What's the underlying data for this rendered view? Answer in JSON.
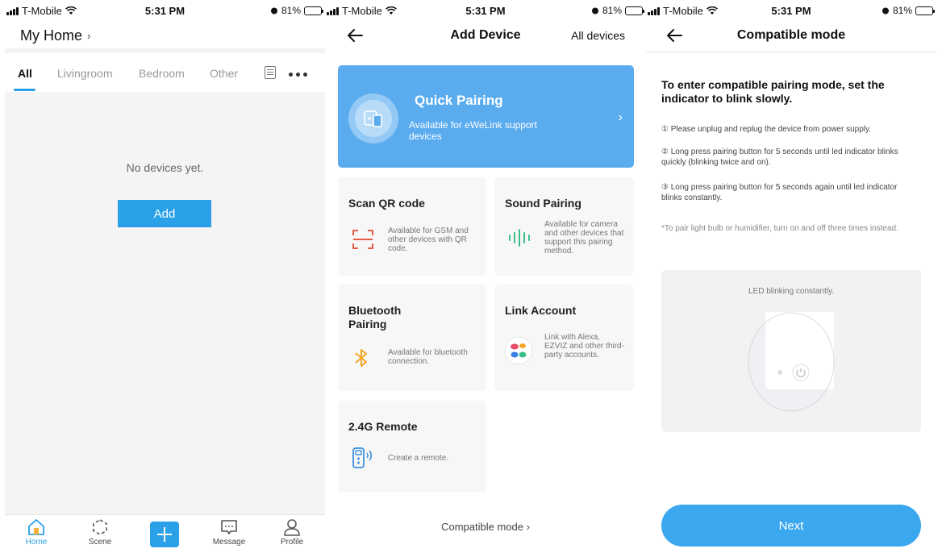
{
  "status": {
    "carrier": "T-Mobile",
    "time": "5:31 PM",
    "battery": "81%",
    "battery_level": 0.81
  },
  "home": {
    "title": "My Home",
    "tabs": [
      "All",
      "Livingroom",
      "Bedroom",
      "Other"
    ],
    "empty_text": "No devices yet.",
    "add_label": "Add",
    "nav": {
      "home": "Home",
      "scene": "Scene",
      "message": "Message",
      "profile": "Profile"
    }
  },
  "add_device": {
    "title": "Add Device",
    "right_action": "All devices",
    "quick_pairing": {
      "title": "Quick Pairing",
      "desc": "Available for eWeLink support devices"
    },
    "cards": {
      "scan_qr": {
        "title": "Scan QR code",
        "desc": "Available for GSM and other devices with QR code."
      },
      "sound": {
        "title": "Sound Pairing",
        "desc": "Available for camera and other devices that support this pairing method."
      },
      "bluetooth": {
        "title": "Bluetooth Pairing",
        "desc": "Available for bluetooth connection."
      },
      "link": {
        "title": "Link Account",
        "desc": "Link with Alexa, EZVIZ and other third-party accounts."
      },
      "remote": {
        "title": "2.4G Remote",
        "desc": "Create a remote."
      }
    },
    "compatible_link": "Compatible mode ›"
  },
  "compatible": {
    "title": "Compatible mode",
    "heading": "To enter compatible pairing mode, set the indicator to blink slowly.",
    "steps": [
      "① Please unplug and replug the device from power supply.",
      "② Long press pairing button for 5 seconds until led indicator blinks quickly (blinking twice and on).",
      "③ Long press pairing button for 5 seconds again until led indicator blinks constantly."
    ],
    "note": "*To pair light bulb or humidifier, turn on and off three times instead.",
    "led_label": "LED blinking constantly.",
    "next_label": "Next"
  },
  "colors": {
    "accent": "#2aa0e8",
    "quick_pairing": "#5aacef",
    "next": "#3aa7ef"
  }
}
